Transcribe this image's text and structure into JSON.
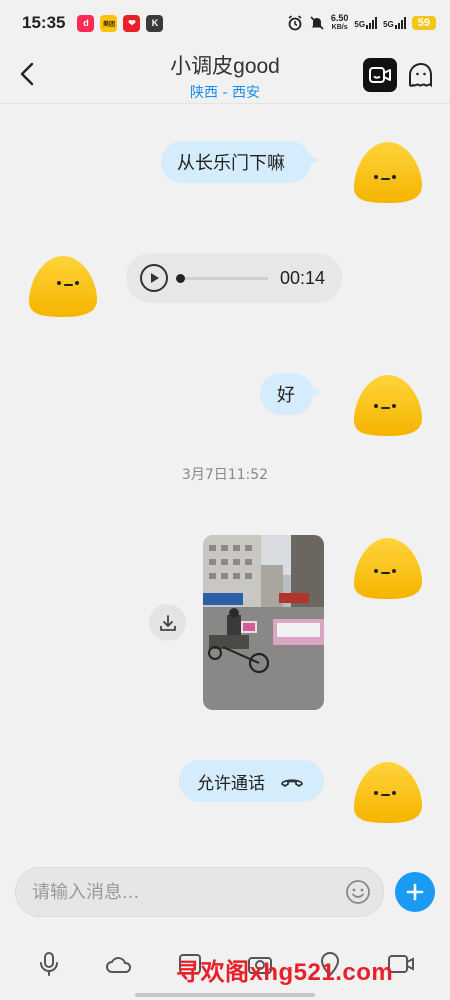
{
  "status_bar": {
    "time": "15:35",
    "apps": [
      {
        "name": "douyin-icon",
        "glyph": "d",
        "color": "#fe2c55"
      },
      {
        "name": "meituan-icon",
        "glyph": "美团",
        "color": "#ffc300"
      },
      {
        "name": "health-icon",
        "glyph": "❤",
        "color": "#e8202a"
      },
      {
        "name": "k-app-icon",
        "glyph": "K",
        "color": "#3a3a3a"
      }
    ],
    "net_speed_value": "6.50",
    "net_speed_unit": "KB/s",
    "signal1_label": "5G",
    "signal2_label": "5G",
    "battery": "59"
  },
  "header": {
    "title": "小调皮good",
    "subtitle": "陕西 - 西安"
  },
  "messages": {
    "m1_text": "从长乐门下嘛",
    "voice_duration": "00:14",
    "m3_text": "好",
    "timestamp": "3月7日11:52",
    "call_text": "允许通话"
  },
  "input": {
    "placeholder": "请输入消息..."
  },
  "watermark": "寻欢阁xhg521.com",
  "colors": {
    "avatar": "#f9c415",
    "bubble": "#d4ecfb",
    "accent": "#1a9af2"
  }
}
